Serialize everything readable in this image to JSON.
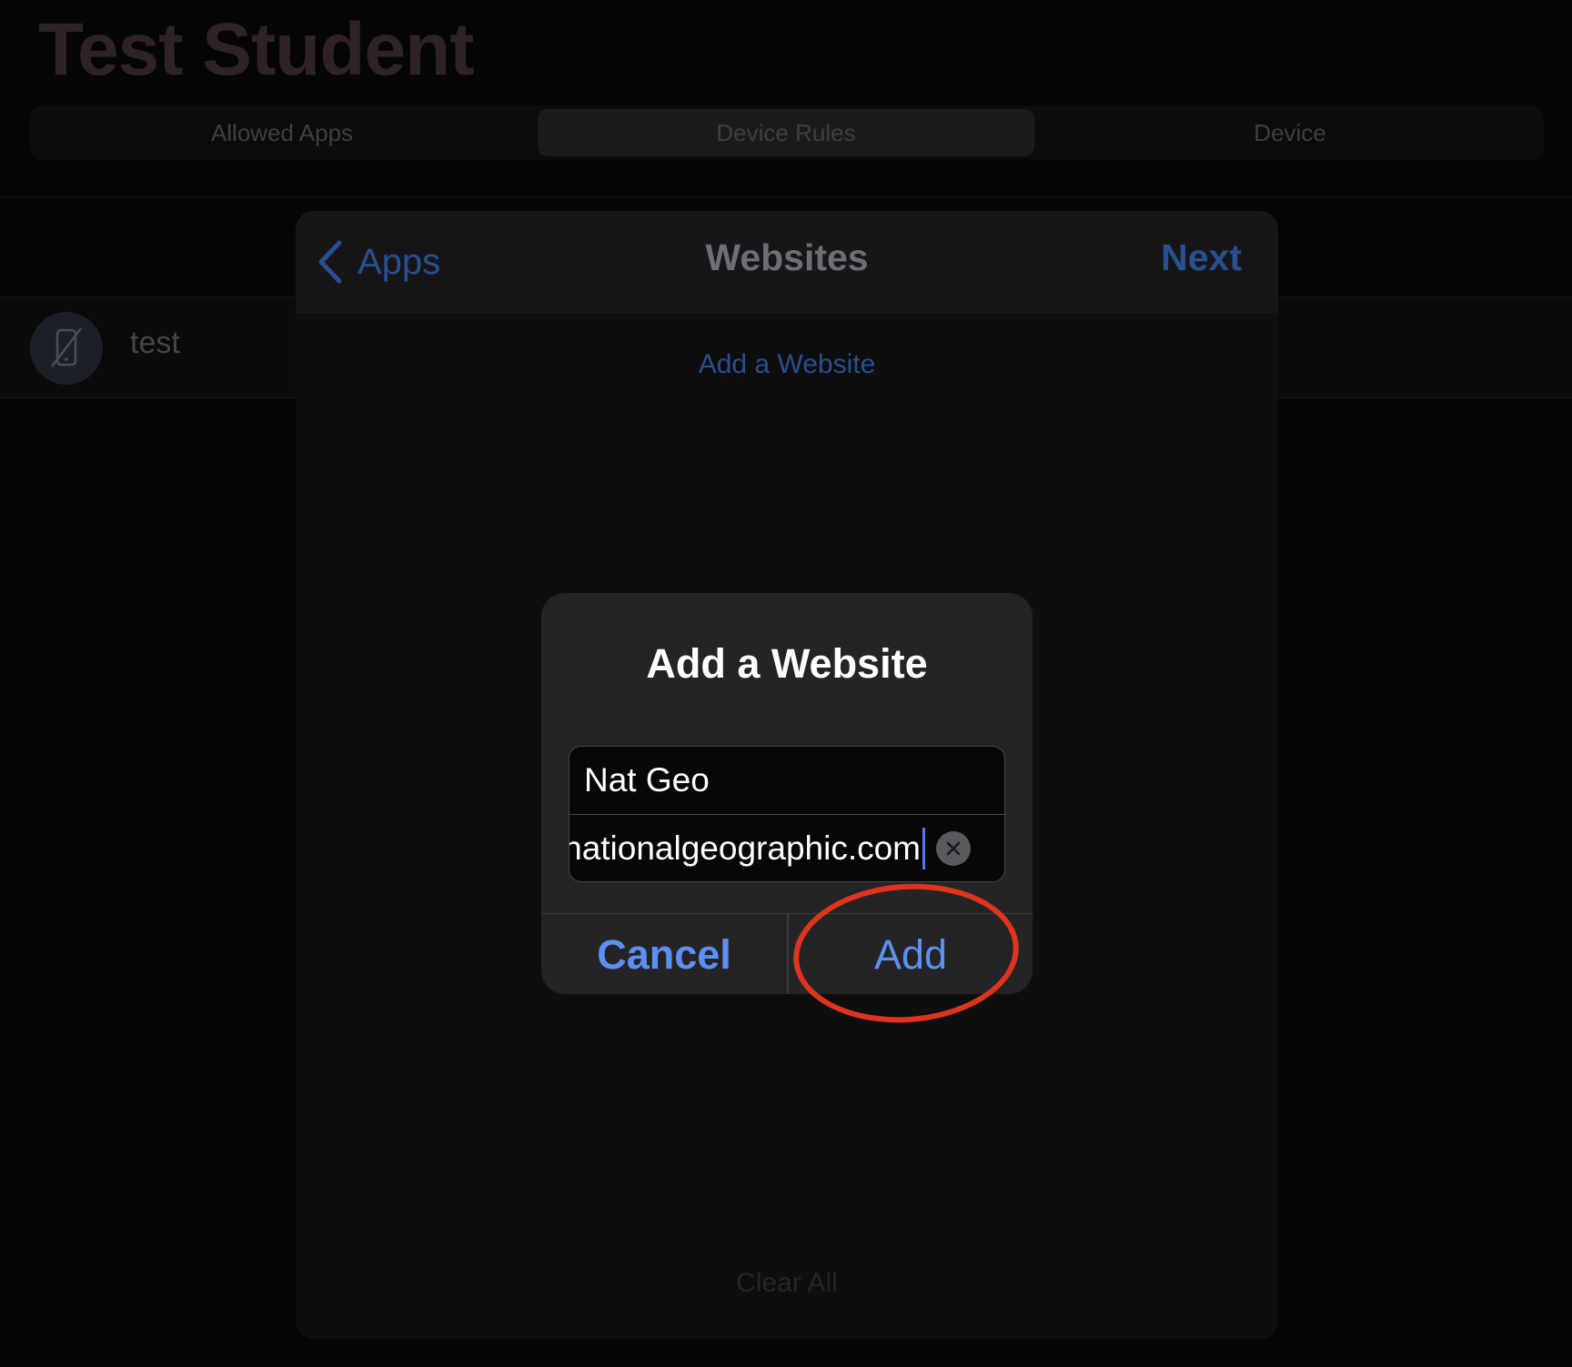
{
  "page": {
    "title": "Test Student",
    "tabs": [
      {
        "label": "Allowed Apps",
        "active": false
      },
      {
        "label": "Device Rules",
        "active": true
      },
      {
        "label": "Device",
        "active": false
      }
    ],
    "row": {
      "label": "test",
      "icon": "phone-slash-icon"
    }
  },
  "sheet": {
    "back_label": "Apps",
    "title": "Websites",
    "next_label": "Next",
    "add_link": "Add a Website",
    "clear_all": "Clear All"
  },
  "alert": {
    "title": "Add a Website",
    "name_value": "Nat Geo",
    "url_value": "nationalgeographic.com",
    "cancel_label": "Cancel",
    "add_label": "Add"
  },
  "colors": {
    "accent": "#5c91f3",
    "annotation": "#e0341f"
  }
}
